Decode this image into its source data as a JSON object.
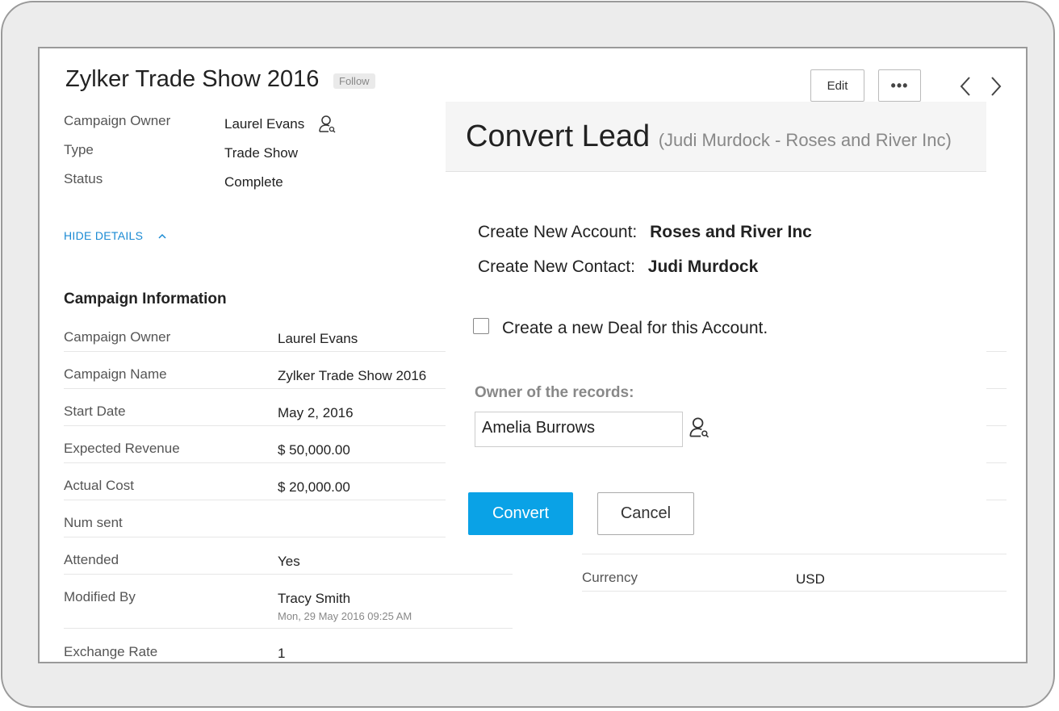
{
  "record": {
    "title": "Zylker Trade Show 2016",
    "follow_label": "Follow",
    "edit_label": "Edit",
    "more_label": "•••",
    "summary": [
      {
        "label": "Campaign Owner",
        "value": "Laurel Evans"
      },
      {
        "label": "Type",
        "value": "Trade Show"
      },
      {
        "label": "Status",
        "value": "Complete"
      }
    ],
    "hide_details_label": "HIDE DETAILS"
  },
  "campaign_info": {
    "heading": "Campaign Information",
    "rows": [
      {
        "label": "Campaign Owner",
        "value": "Laurel Evans"
      },
      {
        "label": "Campaign Name",
        "value": "Zylker Trade Show 2016"
      },
      {
        "label": "Start Date",
        "value": "May 2, 2016"
      },
      {
        "label": "Expected Revenue",
        "value": "$ 50,000.00"
      },
      {
        "label": "Actual Cost",
        "value": "$ 20,000.00"
      },
      {
        "label": "Num sent",
        "value": ""
      },
      {
        "label": "Attended",
        "value": "Yes"
      },
      {
        "label": "Modified By",
        "value": "Tracy Smith",
        "sub": "Mon, 29 May 2016 09:25 AM"
      },
      {
        "label": "Exchange Rate",
        "value": "1"
      }
    ],
    "right_rows": [
      {
        "label": "Currency",
        "value": "USD"
      }
    ]
  },
  "modal": {
    "title": "Convert Lead",
    "subtitle": "(Judi Murdock - Roses and River Inc)",
    "account_label": "Create New Account:",
    "account_value": "Roses and River Inc",
    "contact_label": "Create New Contact:",
    "contact_value": "Judi Murdock",
    "deal_checkbox_label": "Create a new Deal for this Account.",
    "deal_checked": false,
    "owner_label": "Owner of the records:",
    "owner_value": "Amelia Burrows",
    "convert_label": "Convert",
    "cancel_label": "Cancel"
  },
  "colors": {
    "accent": "#0aa2e6",
    "link": "#1a8ad3"
  }
}
